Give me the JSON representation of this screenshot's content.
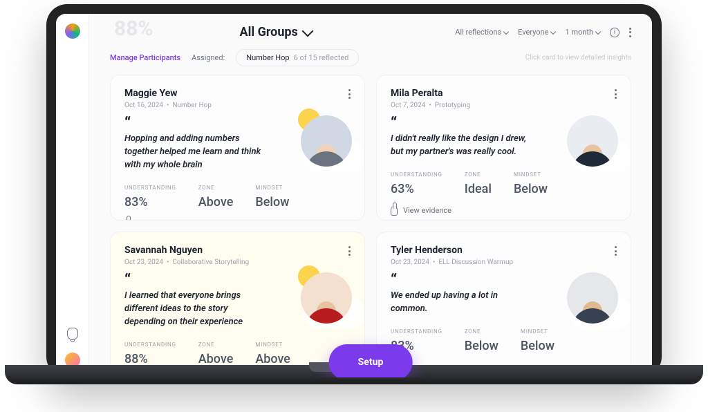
{
  "header": {
    "faded_metric": "88%",
    "groups_label": "All Groups",
    "filters": {
      "reflections": "All reflections",
      "people": "Everyone",
      "period": "1 month"
    }
  },
  "subbar": {
    "manage": "Manage Participants",
    "assigned_label": "Assigned:",
    "pill_title": "Number Hop",
    "pill_count": "6 of 15 reflected",
    "hint": "Click card to view detailed insights"
  },
  "metric_labels": {
    "understanding": "Understanding",
    "zone": "Zone",
    "mindset": "Mindset"
  },
  "evidence_label": "View evidence",
  "fab": "Setup",
  "cards": [
    {
      "name": "Maggie Yew",
      "date": "Oct 16, 2024",
      "tag": "Number Hop",
      "quote": "Hopping and adding numbers together helped me learn and think with my whole brain",
      "understanding": "83%",
      "zone": "Above",
      "mindset": "Below",
      "has_sun": true,
      "avatar_bg": "#cfd8e3",
      "skin": "#f2d2b6",
      "shirt": "#6b7280"
    },
    {
      "name": "Mila Peralta",
      "date": "Oct 7, 2024",
      "tag": "Prototyping",
      "quote": "I didn't really like the design I drew, but my partner's was really cool.",
      "understanding": "63%",
      "zone": "Ideal",
      "mindset": "Below",
      "has_sun": false,
      "avatar_bg": "#e9edf2",
      "skin": "#e8c3a0",
      "shirt": "#1f2937"
    },
    {
      "name": "Savannah Nguyen",
      "date": "Oct 23, 2024",
      "tag": "Collaborative Storytelling",
      "quote": "I learned that everyone brings different ideas to the story depending on their experience",
      "understanding": "88%",
      "zone": "Above",
      "mindset": "Above",
      "has_sun": true,
      "avatar_bg": "#f3e0cf",
      "skin": "#e8c3a0",
      "shirt": "#b91c1c",
      "tint": "yellow"
    },
    {
      "name": "Tyler Henderson",
      "date": "Oct 23, 2024",
      "tag": "ELL Discussion Warmup",
      "quote": "We ended up having a lot in common.",
      "understanding": "83%",
      "zone": "Below",
      "mindset": "Below",
      "has_sun": false,
      "avatar_bg": "#e5e7eb",
      "skin": "#e0b98f",
      "shirt": "#374151"
    }
  ]
}
